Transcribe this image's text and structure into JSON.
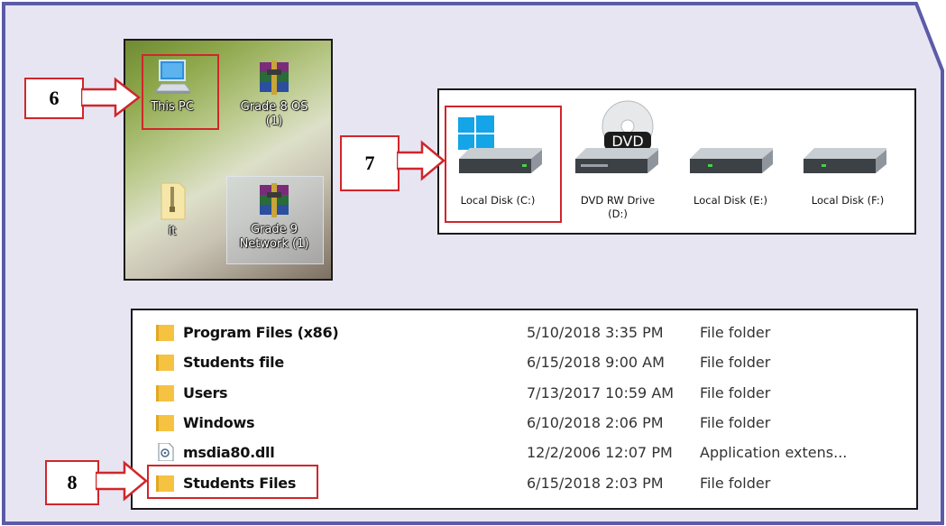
{
  "desktop": {
    "icons": [
      {
        "label_lines": [
          "This PC"
        ]
      },
      {
        "label_lines": [
          "Grade 8 OS",
          "(1)"
        ]
      },
      {
        "label_lines": [
          "it"
        ]
      },
      {
        "label_lines": [
          "Grade 9",
          "Network (1)"
        ]
      }
    ]
  },
  "drives": [
    {
      "label_lines": [
        "Local Disk (C:)"
      ],
      "badge": "windows-logo"
    },
    {
      "label_lines": [
        "DVD RW Drive",
        "(D:)"
      ],
      "badge": "DVD"
    },
    {
      "label_lines": [
        "Local Disk (E:)"
      ],
      "badge": ""
    },
    {
      "label_lines": [
        "Local Disk (F:)"
      ],
      "badge": ""
    }
  ],
  "files": [
    {
      "name": "Program Files (x86)",
      "date": "5/10/2018 3:35 PM",
      "type": "File folder",
      "icon": "folder-icon"
    },
    {
      "name": "Students file",
      "date": "6/15/2018 9:00 AM",
      "type": "File folder",
      "icon": "folder-icon"
    },
    {
      "name": "Users",
      "date": "7/13/2017 10:59 AM",
      "type": "File folder",
      "icon": "folder-icon"
    },
    {
      "name": "Windows",
      "date": "6/10/2018 2:06 PM",
      "type": "File folder",
      "icon": "folder-icon"
    },
    {
      "name": "msdia80.dll",
      "date": "12/2/2006 12:07 PM",
      "type": "Application extens...",
      "icon": "dll-file-icon"
    },
    {
      "name": "Students Files",
      "date": "6/15/2018 2:03 PM",
      "type": "File folder",
      "icon": "folder-icon"
    }
  ],
  "callouts": {
    "step6": "6",
    "step7": "7",
    "step8": "8"
  },
  "colors": {
    "frame_fill": "#e8e5f3",
    "frame_border": "#5b5ba8",
    "callout_red": "#d0262b",
    "folder_yellow": "#f5c242"
  }
}
